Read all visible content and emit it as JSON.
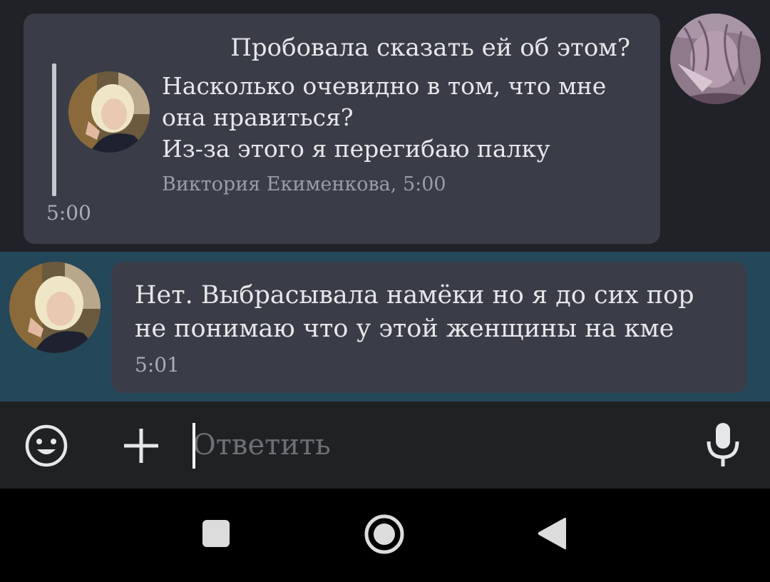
{
  "messages": [
    {
      "type": "outgoing",
      "text": "Пробовала сказать ей об этом?",
      "time": "5:00",
      "quote": {
        "lines": [
          "Насколько очевидно в том, что мне",
          "она нравиться?",
          "Из-за этого я перегибаю палку"
        ],
        "author_time": "Виктория Екименкова, 5:00"
      }
    },
    {
      "type": "incoming",
      "lines": [
        "Нет. Выбрасывала намёки но я до сих пор",
        "не понимаю что у этой женщины на кме"
      ],
      "time": "5:01"
    }
  ],
  "composer": {
    "placeholder": "Ответить",
    "emoji_icon": "smile-emoji-icon",
    "attach_icon": "plus-icon",
    "voice_icon": "microphone-icon"
  },
  "navigation": {
    "recents_icon": "square-icon",
    "home_icon": "circle-icon",
    "back_icon": "triangle-back-icon"
  },
  "colors": {
    "chat_background": "#202227",
    "bubble": "#3a3d48",
    "highlight_row": "#24475a",
    "text": "#e6e7ea",
    "muted_text": "#a9acb6",
    "input_bar": "#202122",
    "nav_bar": "#000000"
  }
}
